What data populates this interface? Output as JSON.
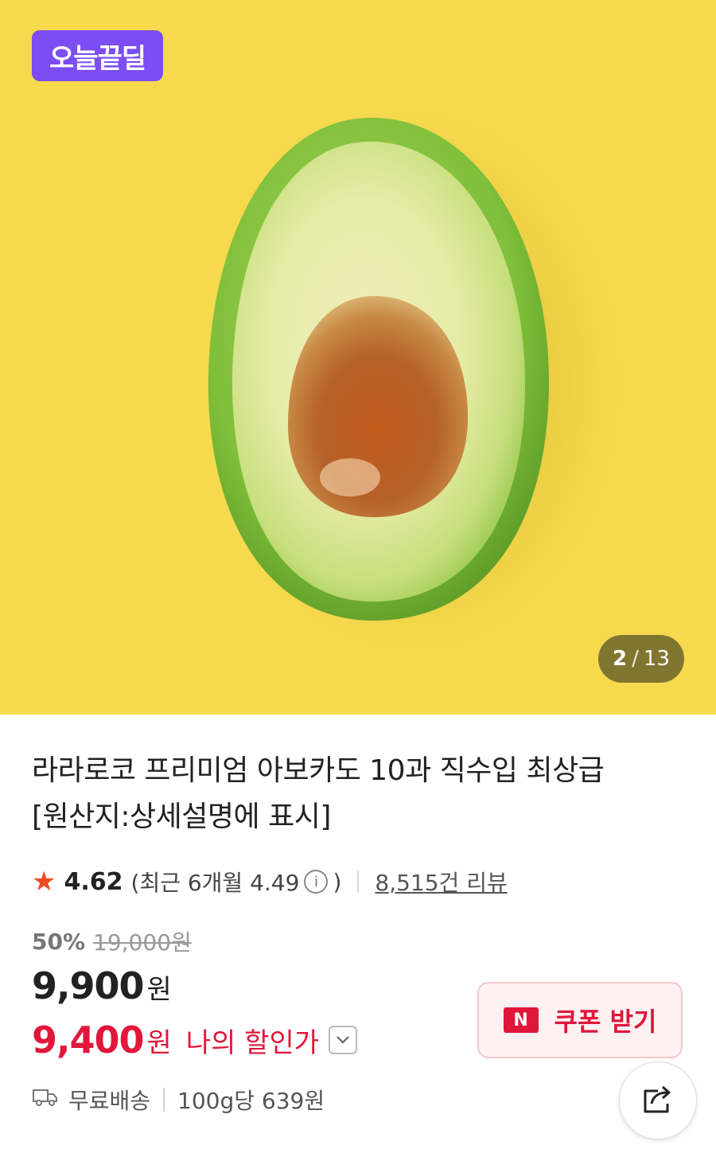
{
  "hero": {
    "badge_label": "오늘끝딜",
    "image_index": "2",
    "image_separator": "/",
    "image_total": "13",
    "image_subject": "avocado-half"
  },
  "product": {
    "title_line1": "라라로코 프리미엄 아보카도 10과 직수입 최상급",
    "title_line2": "[원산지:상세설명에 표시]"
  },
  "rating": {
    "score": "4.62",
    "recent_prefix": "(최근 6개월 4.49",
    "recent_suffix": ")",
    "review_count": "8,515건 리뷰"
  },
  "pricing": {
    "discount_percent": "50%",
    "original_price": "19,000원",
    "sale_price": "9,900",
    "sale_unit": "원",
    "my_price": "9,400",
    "my_unit": "원",
    "my_price_label": "나의 할인가"
  },
  "coupon": {
    "logo_letter": "N",
    "label": "쿠폰 받기"
  },
  "shipping": {
    "delivery": "무료배송",
    "unit_price": "100g당 639원"
  },
  "colors": {
    "accent_red": "#e0173b",
    "badge_purple": "#7b4df2",
    "hero_bg": "#f6d94d",
    "star": "#f04b23"
  },
  "icons": [
    "star-icon",
    "info-icon",
    "chevron-down-icon",
    "truck-icon",
    "share-icon",
    "naver-n-icon"
  ]
}
